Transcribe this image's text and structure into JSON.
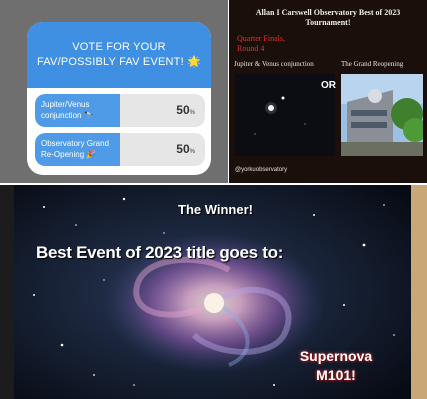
{
  "poll": {
    "question": "VOTE FOR YOUR FAV/POSSIBLY FAV EVENT! 🌟",
    "options": [
      {
        "label": "Jupiter/Venus conjunction 🔭",
        "percent": "50",
        "percent_sign": "%",
        "fill_fraction": 0.5
      },
      {
        "label": "Observatory Grand Re-Opening 🎉",
        "percent": "50",
        "percent_sign": "%",
        "fill_fraction": 0.5
      }
    ],
    "colors": {
      "header": "#3f8fe3",
      "fill": "#4f9be8",
      "track": "#e6e6e6"
    }
  },
  "tournament": {
    "title": "Allan I Carswell Observatory Best of 2023 Tournament!",
    "round": "Quarter Finals, Round 4",
    "left_label": "Jupiter & Venus conjunction",
    "right_label": "The Grand Reopening",
    "versus": "OR",
    "handle": "@yorkuobservatory",
    "colors": {
      "round": "#e0332b",
      "background": "#1a0f0a"
    }
  },
  "winner": {
    "heading": "The Winner!",
    "subheading": "Best Event of 2023 title goes to:",
    "answer_line1": "Supernova",
    "answer_line2": "M101!",
    "colors": {
      "answer_glow": "#ff4040"
    }
  }
}
